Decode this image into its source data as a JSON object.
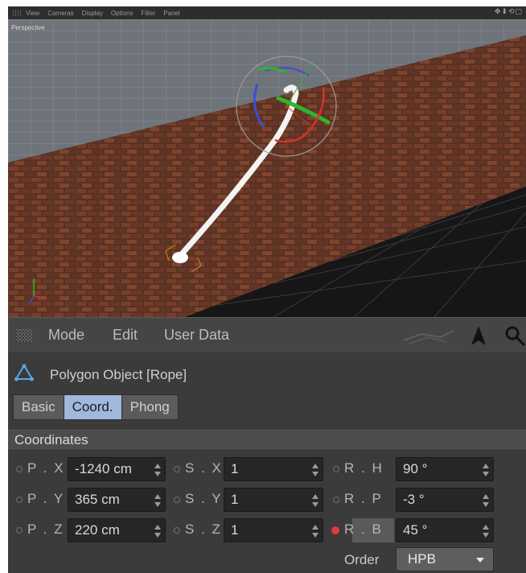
{
  "viewport": {
    "menu": [
      "View",
      "Cameras",
      "Display",
      "Options",
      "Filter",
      "Panel"
    ],
    "label": "Perspective"
  },
  "am": {
    "menu": [
      "Mode",
      "Edit",
      "User Data"
    ],
    "object_title": "Polygon Object [Rope]",
    "tabs": [
      {
        "label": "Basic",
        "active": false
      },
      {
        "label": "Coord.",
        "active": true
      },
      {
        "label": "Phong",
        "active": false
      }
    ],
    "section": "Coordinates",
    "fields": {
      "px": {
        "label": "P . X",
        "value": "-1240 cm"
      },
      "py": {
        "label": "P . Y",
        "value": "365 cm"
      },
      "pz": {
        "label": "P . Z",
        "value": "220 cm"
      },
      "sx": {
        "label": "S . X",
        "value": "1"
      },
      "sy": {
        "label": "S . Y",
        "value": "1"
      },
      "sz": {
        "label": "S . Z",
        "value": "1"
      },
      "rh": {
        "label": "R . H",
        "value": "90 °"
      },
      "rp": {
        "label": "R . P",
        "value": "-3 °"
      },
      "rb": {
        "label": "R . B",
        "value": "45 °",
        "keyframed": true
      }
    },
    "order": {
      "label": "Order",
      "value": "HPB"
    }
  },
  "colors": {
    "active_tab": "#9fb8dc",
    "keyframe_dot": "#e23b3b",
    "axis_x": "#d9302b",
    "axis_y": "#2fb52f",
    "axis_z": "#3a4fd4"
  },
  "icons": [
    "grip-icon",
    "arrows-icon",
    "cursor-icon",
    "search-icon",
    "polygon-object-icon",
    "spin-arrows-icon",
    "dropdown-caret-icon"
  ]
}
